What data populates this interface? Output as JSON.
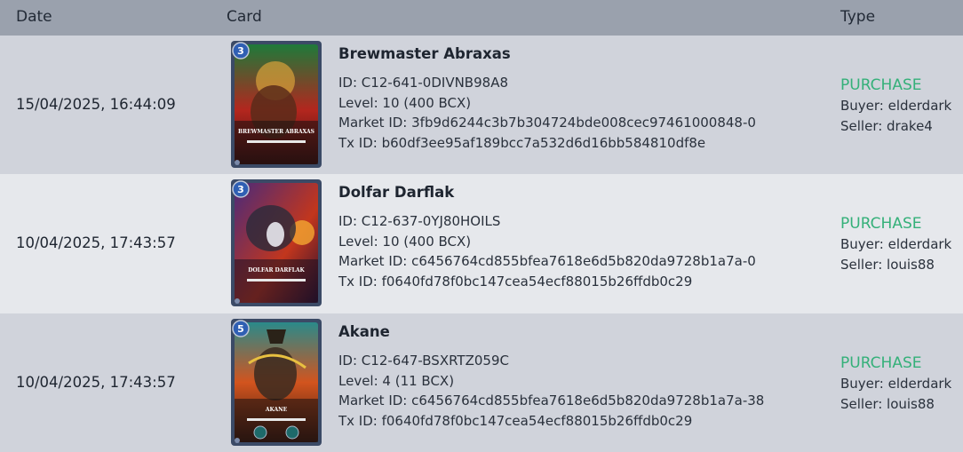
{
  "columns": {
    "date": "Date",
    "card": "Card",
    "type": "Type"
  },
  "rows": [
    {
      "date": "15/04/2025, 16:44:09",
      "card_name": "Brewmaster Abraxas",
      "art_label": "BREWMASTER ABRAXAS",
      "mana": "3",
      "id": "ID: C12-641-0DIVNB98A8",
      "level": "Level: 10 (400 BCX)",
      "market_id": "Market ID: 3fb9d6244c3b7b304724bde008cec97461000848-0",
      "tx_id": "Tx ID: b60df3ee95af189bcc7a532d6d16bb584810df8e",
      "type": "PURCHASE",
      "buyer": "Buyer: elderdark",
      "seller": "Seller: drake4",
      "colors": {
        "bg1": "#1e7a3a",
        "bg2": "#b3261e",
        "accent": "#d9a23a"
      }
    },
    {
      "date": "10/04/2025, 17:43:57",
      "card_name": "Dolfar Darflak",
      "art_label": "DOLFAR DARFLAK",
      "mana": "3",
      "id": "ID: C12-637-0YJ80HOILS",
      "level": "Level: 10 (400 BCX)",
      "market_id": "Market ID: c6456764cd855bfea7618e6d5b820da9728b1a7a-0",
      "tx_id": "Tx ID: f0640fd78f0bc147cea54ecf88015b26ffdb0c29",
      "type": "PURCHASE",
      "buyer": "Buyer: elderdark",
      "seller": "Seller: louis88",
      "colors": {
        "bg1": "#4a2a7a",
        "bg2": "#c2361d",
        "accent": "#f0a030"
      }
    },
    {
      "date": "10/04/2025, 17:43:57",
      "card_name": "Akane",
      "art_label": "AKANE",
      "mana": "5",
      "id": "ID: C12-647-BSXRTZ059C",
      "level": "Level: 4 (11 BCX)",
      "market_id": "Market ID: c6456764cd855bfea7618e6d5b820da9728b1a7a-38",
      "tx_id": "Tx ID: f0640fd78f0bc147cea54ecf88015b26ffdb0c29",
      "type": "PURCHASE",
      "buyer": "Buyer: elderdark",
      "seller": "Seller: louis88",
      "colors": {
        "bg1": "#2a8a8a",
        "bg2": "#d2541e",
        "accent": "#e8c040"
      }
    }
  ]
}
